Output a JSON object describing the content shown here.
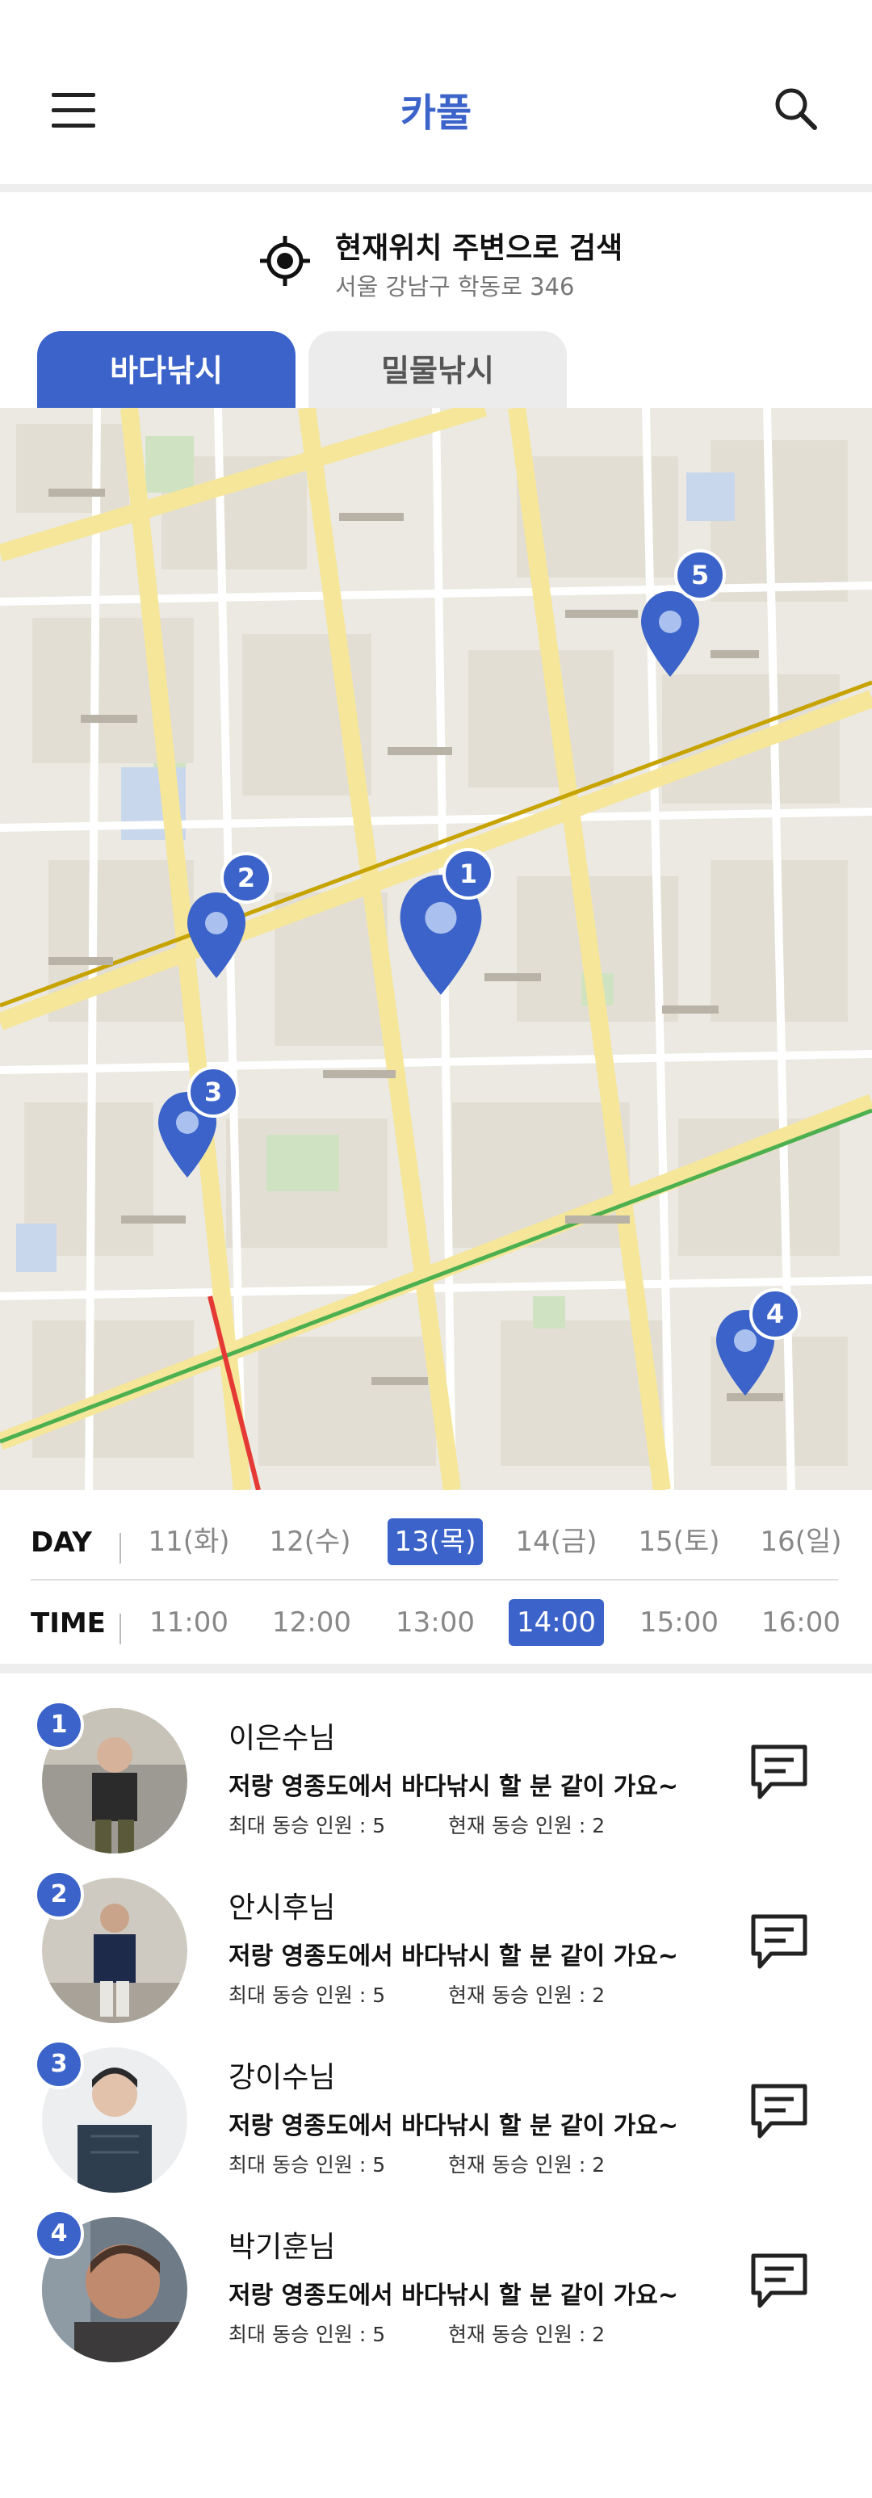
{
  "header": {
    "title": "카풀",
    "menu_icon": "hamburger-menu-icon",
    "search_icon": "search-icon"
  },
  "location": {
    "title": "현재위치 주변으로 검색",
    "address": "서울 강남구 학동로 346",
    "icon": "target-location-icon"
  },
  "tabs": [
    {
      "label": "바다낚시",
      "active": true
    },
    {
      "label": "밀물낚시",
      "active": false
    }
  ],
  "map": {
    "pins": [
      {
        "number": "1"
      },
      {
        "number": "2"
      },
      {
        "number": "3"
      },
      {
        "number": "4"
      },
      {
        "number": "5"
      }
    ],
    "pin_color": "#3b63c9"
  },
  "day": {
    "label": "DAY",
    "options": [
      "11(화)",
      "12(수)",
      "13(목)",
      "14(금)",
      "15(토)",
      "16(일)"
    ],
    "selected": "13(목)"
  },
  "time": {
    "label": "TIME",
    "options": [
      "11:00",
      "12:00",
      "13:00",
      "14:00",
      "15:00",
      "16:00"
    ],
    "selected": "14:00"
  },
  "posts": [
    {
      "number": "1",
      "name": "이은수님",
      "message": "저랑 영종도에서 바다낚시 할 분 같이 가요~",
      "max": "최대 동승 인원 : 5",
      "current": "현재 동승 인원 : 2"
    },
    {
      "number": "2",
      "name": "안시후님",
      "message": "저랑 영종도에서 바다낚시 할 분 같이 가요~",
      "max": "최대 동승 인원 : 5",
      "current": "현재 동승 인원 : 2"
    },
    {
      "number": "3",
      "name": "강이수님",
      "message": "저랑 영종도에서 바다낚시 할 분 같이 가요~",
      "max": "최대 동승 인원 : 5",
      "current": "현재 동승 인원 : 2"
    },
    {
      "number": "4",
      "name": "박기훈님",
      "message": "저랑 영종도에서 바다낚시 할 분 같이 가요~",
      "max": "최대 동승 인원 : 5",
      "current": "현재 동승 인원 : 2"
    }
  ],
  "colors": {
    "accent": "#3b63c9"
  }
}
